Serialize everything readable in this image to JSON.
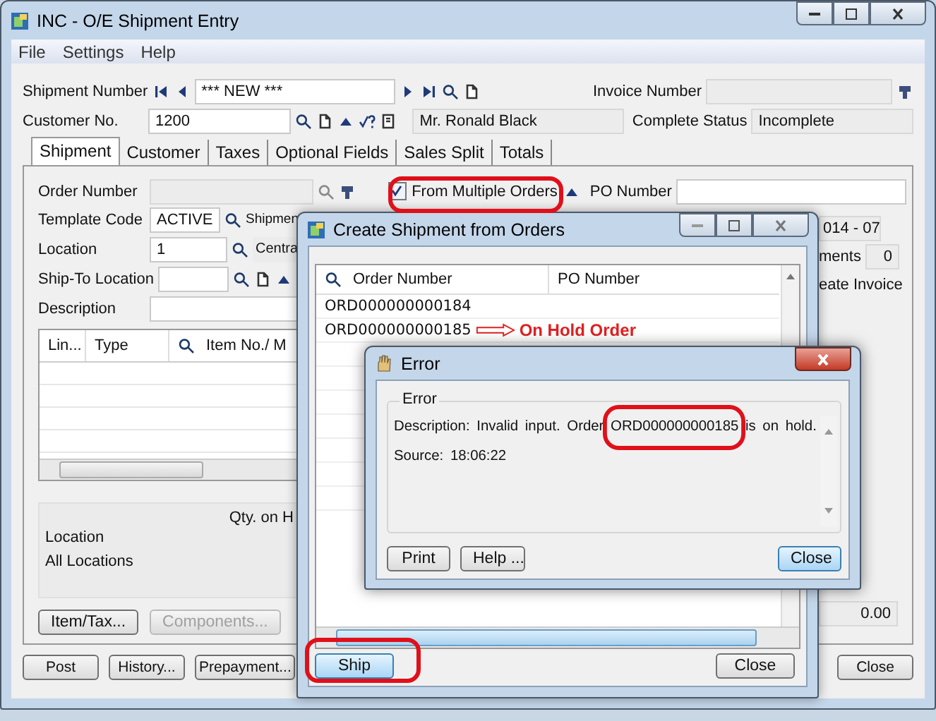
{
  "main_window": {
    "title": "INC - O/E Shipment Entry",
    "menu": [
      "File",
      "Settings",
      "Help"
    ],
    "header": {
      "shipment_number": {
        "label": "Shipment Number",
        "value": "*** NEW ***"
      },
      "invoice_number": {
        "label": "Invoice Number"
      },
      "customer_no": {
        "label": "Customer No.",
        "value": "1200"
      },
      "customer_name": "Mr. Ronald Black",
      "complete_status": {
        "label": "Complete Status",
        "value": "Incomplete"
      }
    },
    "tabs": [
      {
        "label": "Shipment",
        "selected": true
      },
      {
        "label": "Customer",
        "selected": false
      },
      {
        "label": "Taxes",
        "selected": false
      },
      {
        "label": "Optional Fields",
        "selected": false
      },
      {
        "label": "Sales Split",
        "selected": false
      },
      {
        "label": "Totals",
        "selected": false
      }
    ],
    "shipment_tab": {
      "order_number": {
        "label": "Order Number"
      },
      "from_multiple_orders": {
        "label": "From Multiple Orders",
        "checked": true
      },
      "po_number": {
        "label": "PO Number"
      },
      "template_code": {
        "label": "Template Code",
        "value": "ACTIVE",
        "side_label": "Shipmen"
      },
      "location": {
        "label": "Location",
        "value": "1",
        "side_label": "Centra"
      },
      "ship_to_location": {
        "label": "Ship-To Location"
      },
      "description": {
        "label": "Description"
      },
      "lines_table": {
        "columns": [
          "Lin...",
          "Type",
          "Item No./ M"
        ]
      },
      "period_value": "014 - 07",
      "shipments_label": "ments",
      "shipments_value": "0",
      "create_invoice_label": "eate Invoice",
      "quantities": {
        "heading": "Qty. on H",
        "location_label": "Location",
        "location_value": "All Locations"
      },
      "buttons": [
        {
          "label": "Item/Tax...",
          "disabled": false
        },
        {
          "label": "Components...",
          "disabled": true
        }
      ],
      "amount": "0.00"
    },
    "footer_buttons": [
      "Post",
      "History...",
      "Prepayment...",
      "Close"
    ]
  },
  "orders_dialog": {
    "title": "Create Shipment from Orders",
    "columns": [
      "Order Number",
      "PO Number"
    ],
    "rows": [
      {
        "order_number": "ORD000000000184"
      },
      {
        "order_number": "ORD000000000185",
        "note": "On Hold Order"
      }
    ],
    "buttons": [
      {
        "label": "Ship",
        "focused": true
      },
      {
        "label": "Close",
        "focused": false
      }
    ]
  },
  "error_dialog": {
    "title": "Error",
    "group": "Error",
    "description": "Description: Invalid input. Order ORD000000000185 is on hold.",
    "source": "Source:  18:06:22",
    "buttons": [
      {
        "label": "Print",
        "focused": false
      },
      {
        "label": "Help ...",
        "focused": false
      },
      {
        "label": "Close",
        "focused": true
      }
    ]
  }
}
